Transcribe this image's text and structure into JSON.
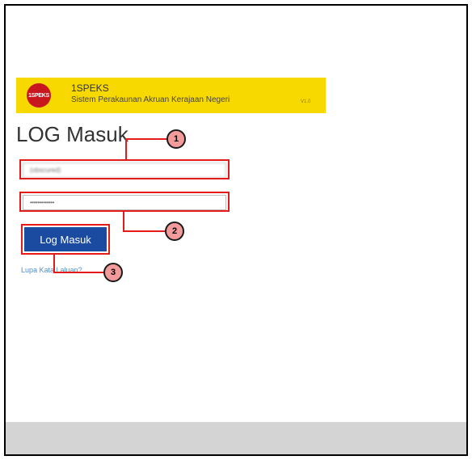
{
  "header": {
    "logo_text": "1SPEKS",
    "app_name": "1SPEKS",
    "app_subtitle": "Sistem Perakaunan Akruan Kerajaan Negeri",
    "version": "V1.0"
  },
  "login": {
    "title": "LOG Masuk",
    "username_value": "(obscured)",
    "password_value": "•••••••••••••",
    "submit_label": "Log Masuk",
    "forgot_link": "Lupa Kata Laluan?"
  },
  "callouts": [
    "1",
    "2",
    "3"
  ],
  "colors": {
    "header_bg": "#f7d900",
    "button_bg": "#1b4aa1",
    "highlight": "#e41b1b",
    "callout_fill": "#f39a9a",
    "link": "#4a8fd4"
  }
}
